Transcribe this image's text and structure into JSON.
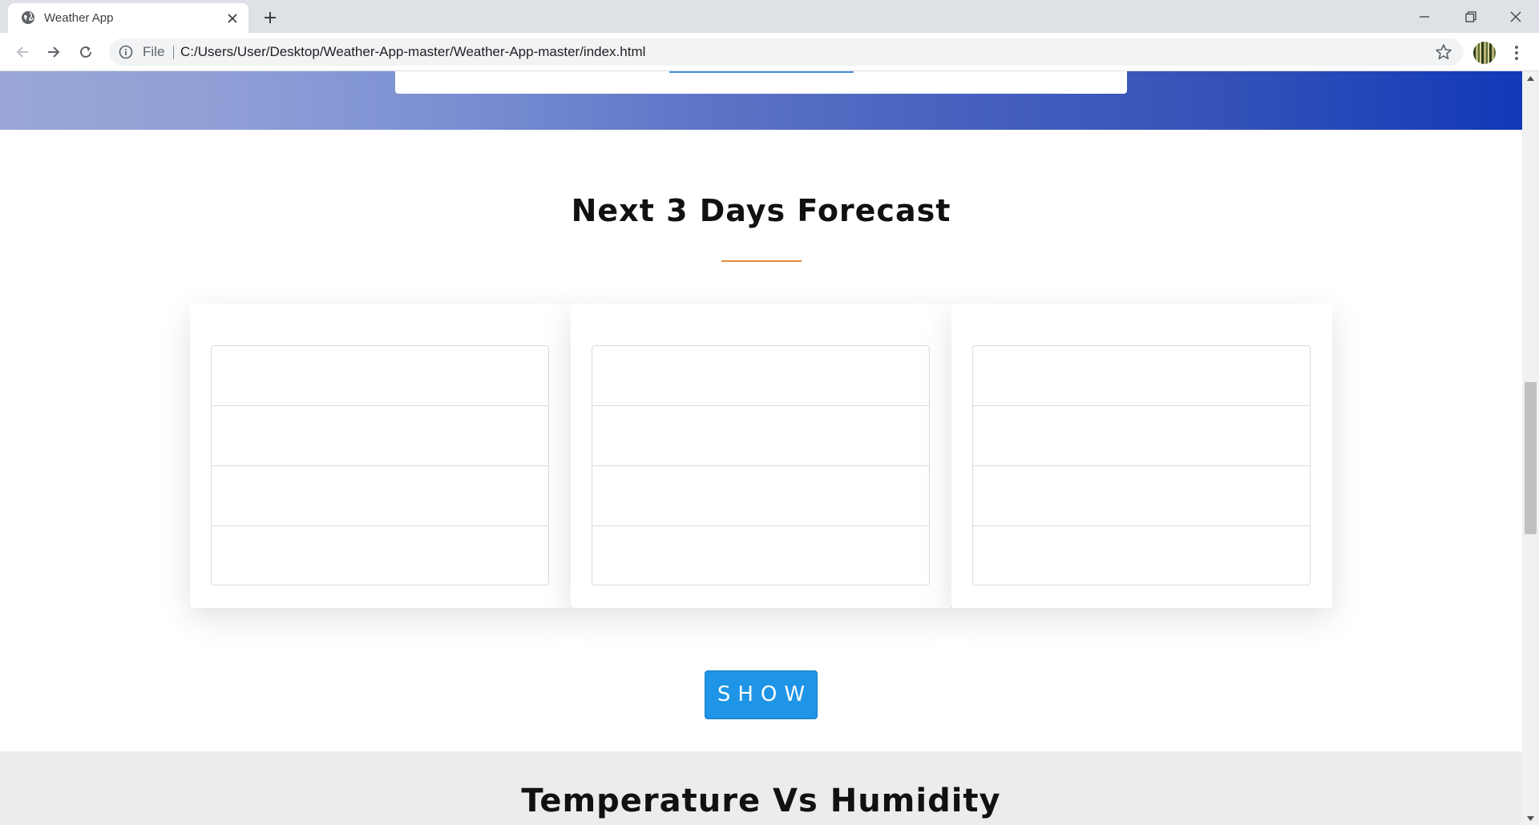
{
  "browser": {
    "tab_title": "Weather App",
    "omnibox_scheme_label": "File",
    "url": "C:/Users/User/Desktop/Weather-App-master/Weather-App-master/index.html"
  },
  "page": {
    "forecast_title": "Next 3 Days Forecast",
    "show_button_label": "SHOW",
    "humidity_title": "Temperature Vs Humidity",
    "forecast_cards": [
      {
        "rows": [
          "",
          "",
          "",
          ""
        ]
      },
      {
        "rows": [
          "",
          "",
          "",
          ""
        ]
      },
      {
        "rows": [
          "",
          "",
          "",
          ""
        ]
      }
    ]
  },
  "colors": {
    "accent_underline": "#e08a3c",
    "show_button": "#1e95e6",
    "hero_gradient_end": "#1239b8"
  }
}
